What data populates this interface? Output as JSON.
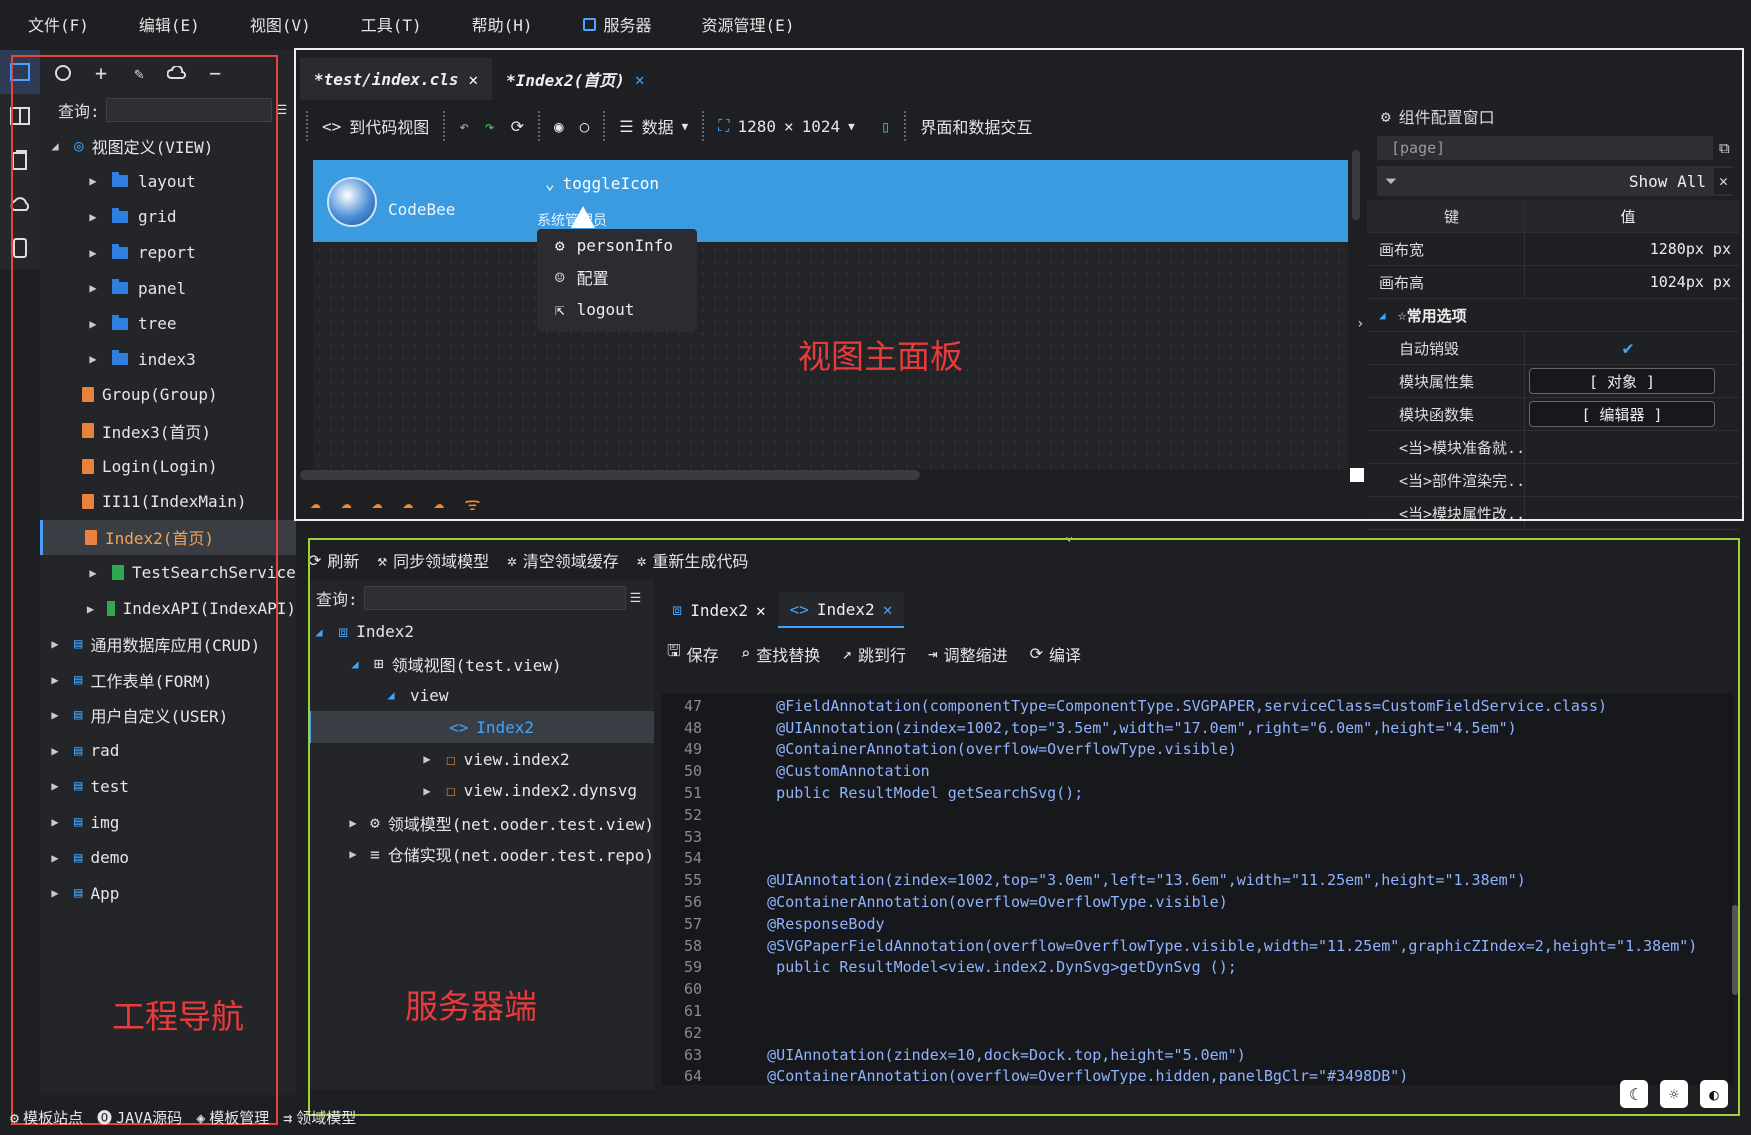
{
  "menubar": {
    "items": [
      "文件(F)",
      "编辑(E)",
      "视图(V)",
      "工具(T)",
      "帮助(H)",
      "服务器",
      "资源管理(E)"
    ]
  },
  "left": {
    "query_label": "查询:",
    "tree": [
      {
        "label": "视图定义(VIEW)",
        "kind": "root"
      },
      {
        "label": "layout",
        "kind": "folder"
      },
      {
        "label": "grid",
        "kind": "folder"
      },
      {
        "label": "report",
        "kind": "folder"
      },
      {
        "label": "panel",
        "kind": "folder"
      },
      {
        "label": "tree",
        "kind": "folder"
      },
      {
        "label": "index3",
        "kind": "folder"
      },
      {
        "label": "Group(Group)",
        "kind": "file"
      },
      {
        "label": "Index3(首页)",
        "kind": "file"
      },
      {
        "label": "Login(Login)",
        "kind": "file"
      },
      {
        "label": "II11(IndexMain)",
        "kind": "file"
      },
      {
        "label": "Index2(首页)",
        "kind": "file",
        "selected": true
      },
      {
        "label": "TestSearchService",
        "kind": "green"
      },
      {
        "label": "IndexAPI(IndexAPI)",
        "kind": "green"
      },
      {
        "label": "通用数据库应用(CRUD)",
        "kind": "top"
      },
      {
        "label": "工作表单(FORM)",
        "kind": "top"
      },
      {
        "label": "用户自定义(USER)",
        "kind": "top"
      },
      {
        "label": "rad",
        "kind": "top"
      },
      {
        "label": "test",
        "kind": "top"
      },
      {
        "label": "img",
        "kind": "top"
      },
      {
        "label": "demo",
        "kind": "top"
      },
      {
        "label": "App",
        "kind": "top"
      }
    ],
    "annotation": "工程导航"
  },
  "design": {
    "tabs": [
      {
        "label": "*test/index.cls",
        "active": false
      },
      {
        "label": "*Index2(首页)",
        "active": true
      }
    ],
    "toolbar": {
      "to_code": "到代码视图",
      "data": "数据",
      "width": "1280",
      "times": "×",
      "height": "1024",
      "interaction": "界面和数据交互"
    },
    "canvas": {
      "logo_text": "CodeBee",
      "toggle": "toggleIcon",
      "sysadmin": "系统管理员",
      "popup": [
        "personInfo",
        "配置",
        "logout"
      ]
    },
    "annotation": "视图主面板"
  },
  "props": {
    "title": "组件配置窗口",
    "page_field": "[page]",
    "show_all": "Show All",
    "col_key": "键",
    "col_value": "值",
    "rows": [
      {
        "k": "画布宽",
        "v": "1280px px"
      },
      {
        "k": "画布高",
        "v": "1024px px"
      }
    ],
    "section": "常用选项",
    "opts": [
      {
        "k": "自动销毁",
        "v": "✔",
        "type": "check"
      },
      {
        "k": "模块属性集",
        "v": "[ 对象 ]",
        "type": "btn"
      },
      {
        "k": "模块函数集",
        "v": "[ 编辑器 ]",
        "type": "btn"
      },
      {
        "k": "<当>模块准备就...",
        "v": "",
        "type": "text"
      },
      {
        "k": "<当>部件渲染完...",
        "v": "",
        "type": "text"
      },
      {
        "k": "<当>模块属性改...",
        "v": "",
        "type": "text"
      }
    ]
  },
  "server": {
    "toolbar": [
      "刷新",
      "同步领域模型",
      "清空领域缓存",
      "重新生成代码"
    ],
    "query_label": "查询:",
    "tree": [
      {
        "label": "Index2",
        "indent": 0
      },
      {
        "label": "领域视图(test.view)",
        "indent": 1
      },
      {
        "label": "view",
        "indent": 2
      },
      {
        "label": "Index2",
        "indent": 3,
        "selected": true
      },
      {
        "label": "view.index2",
        "indent": 3
      },
      {
        "label": "view.index2.dynsvg",
        "indent": 3
      },
      {
        "label": "领域模型(net.ooder.test.view)",
        "indent": 1
      },
      {
        "label": "仓储实现(net.ooder.test.repo)",
        "indent": 1
      }
    ],
    "annotation": "服务器端"
  },
  "editor": {
    "tabs": [
      "Index2",
      "Index2"
    ],
    "toolbar": [
      "保存",
      "查找替换",
      "跳到行",
      "调整缩进",
      "编译"
    ],
    "lines": [
      {
        "n": "47",
        "t": "      @FieldAnnotation(componentType=ComponentType.SVGPAPER,serviceClass=CustomFieldService.class)"
      },
      {
        "n": "48",
        "t": "      @UIAnnotation(zindex=1002,top=\"3.5em\",width=\"17.0em\",right=\"6.0em\",height=\"4.5em\")"
      },
      {
        "n": "49",
        "t": "      @ContainerAnnotation(overflow=OverflowType.visible)"
      },
      {
        "n": "50",
        "t": "      @CustomAnnotation"
      },
      {
        "n": "51",
        "t": "      public ResultModel getSearchSvg();"
      },
      {
        "n": "52",
        "t": ""
      },
      {
        "n": "53",
        "t": ""
      },
      {
        "n": "54",
        "t": ""
      },
      {
        "n": "55",
        "t": "     @UIAnnotation(zindex=1002,top=\"3.0em\",left=\"13.6em\",width=\"11.25em\",height=\"1.38em\")"
      },
      {
        "n": "56",
        "t": "     @ContainerAnnotation(overflow=OverflowType.visible)"
      },
      {
        "n": "57",
        "t": "     @ResponseBody"
      },
      {
        "n": "58",
        "t": "     @SVGPaperFieldAnnotation(overflow=OverflowType.visible,width=\"11.25em\",graphicZIndex=2,height=\"1.38em\")"
      },
      {
        "n": "59",
        "t": "      public ResultModel<view.index2.DynSvg>getDynSvg ();"
      },
      {
        "n": "60",
        "t": ""
      },
      {
        "n": "61",
        "t": ""
      },
      {
        "n": "62",
        "t": ""
      },
      {
        "n": "63",
        "t": "     @UIAnnotation(zindex=10,dock=Dock.top,height=\"5.0em\")"
      },
      {
        "n": "64",
        "t": "     @ContainerAnnotation(overflow=OverflowType.hidden,panelBgClr=\"#3498DB\")"
      }
    ]
  },
  "bottom": {
    "items": [
      "模板站点",
      "JAVA源码",
      "模板管理",
      "领域模型"
    ]
  },
  "colors": {
    "accent": "#3ea6ff",
    "banner": "#3b9be0",
    "annotation_red": "#e83b3b",
    "frame_red": "#e8443f",
    "frame_green": "#9bd13a"
  }
}
